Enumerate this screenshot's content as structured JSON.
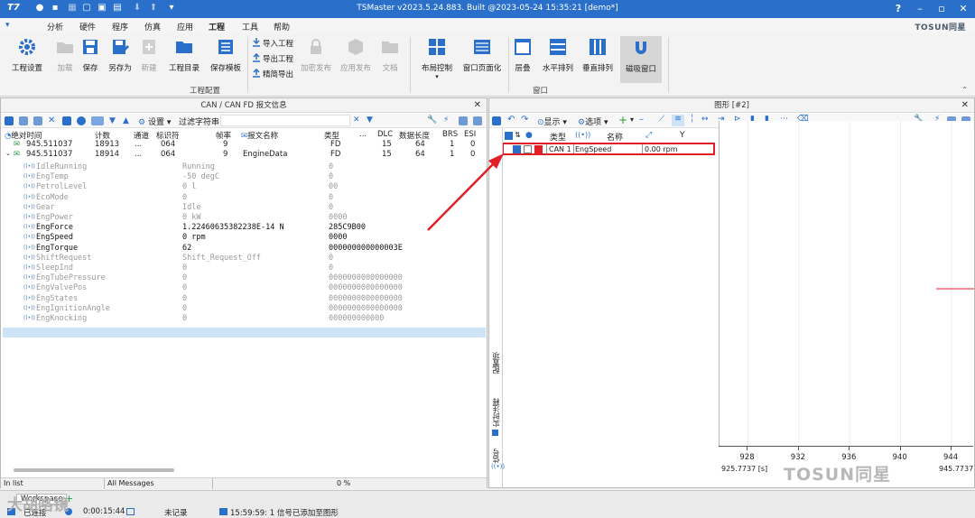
{
  "app": {
    "title": "TSMaster v2023.5.24.883. Built @2023-05-24 15:35:21 [demo*]"
  },
  "menu": {
    "items": [
      "分析",
      "硬件",
      "程序",
      "仿真",
      "应用",
      "工程",
      "工具",
      "帮助"
    ],
    "active": "工程",
    "brand": "TOSUN同星"
  },
  "ribbon": {
    "buttons": {
      "settings": "工程设置",
      "load": "加载",
      "save": "保存",
      "saveas": "另存为",
      "new": "新建",
      "dir": "工程目录",
      "savetpl": "保存模板",
      "import": "导入工程",
      "export": "导出工程",
      "simple": "精简导出",
      "encrypt": "加密发布",
      "publish": "应用发布",
      "doc": "文档",
      "layout": "布局控制",
      "pageize": "窗口页面化",
      "cascade": "层叠",
      "horiz": "水平排列",
      "vert": "垂直排列",
      "magnet": "磁吸窗口"
    },
    "group_project": "工程配置",
    "group_window": "窗口"
  },
  "can_panel": {
    "title": "CAN / CAN FD 报文信息",
    "settings_label": "设置",
    "filter_label": "过滤字符串:",
    "columns": [
      "绝对时间",
      "计数",
      "通道",
      "标识符",
      "帧率",
      "报文名称",
      "类型",
      "...",
      "DLC",
      "数据长度",
      "BRS",
      "ESI"
    ],
    "rows": [
      {
        "time": "945.511037",
        "count": "18913",
        "ch": "...",
        "id": "064",
        "rate": "9",
        "name": "",
        "type": "FD",
        "dots": "...",
        "dlc": "15",
        "len": "64",
        "brs": "1",
        "esi": "0"
      },
      {
        "time": "945.511037",
        "count": "18914",
        "ch": "...",
        "id": "064",
        "rate": "9",
        "name": "EngineData",
        "type": "FD",
        "dots": "...",
        "dlc": "15",
        "len": "64",
        "brs": "1",
        "esi": "0"
      }
    ],
    "signals": [
      {
        "name": "IdleRunning",
        "value": "Running",
        "raw": "0",
        "on": false
      },
      {
        "name": "EngTemp",
        "value": "-50 degC",
        "raw": "0",
        "on": false
      },
      {
        "name": "PetrolLevel",
        "value": "0 l",
        "raw": "00",
        "on": false
      },
      {
        "name": "EcoMode",
        "value": "0",
        "raw": "0",
        "on": false
      },
      {
        "name": "Gear",
        "value": "Idle",
        "raw": "0",
        "on": false
      },
      {
        "name": "EngPower",
        "value": "0 kW",
        "raw": "0000",
        "on": false
      },
      {
        "name": "EngForce",
        "value": "1.22460635382238E-14 N",
        "raw": "285C9B00",
        "on": true
      },
      {
        "name": "EngSpeed",
        "value": "0 rpm",
        "raw": "0000",
        "on": true
      },
      {
        "name": "EngTorque",
        "value": "62",
        "raw": "000000000000003E",
        "on": true
      },
      {
        "name": "ShiftRequest",
        "value": "Shift_Request_Off",
        "raw": "0",
        "on": false
      },
      {
        "name": "SleepInd",
        "value": "0",
        "raw": "0",
        "on": false
      },
      {
        "name": "EngTubePressure",
        "value": "0",
        "raw": "0000000000000000",
        "on": false
      },
      {
        "name": "EngValvePos",
        "value": "0",
        "raw": "0000000000000000",
        "on": false
      },
      {
        "name": "EngStates",
        "value": "0",
        "raw": "0000000000000000",
        "on": false
      },
      {
        "name": "EngIgnitionAngle",
        "value": "0",
        "raw": "0000000000000000",
        "on": false
      },
      {
        "name": "EngKnocking",
        "value": "0",
        "raw": "000000000000",
        "on": false
      }
    ],
    "status": {
      "mode": "In list",
      "filter": "All Messages",
      "progress": "0 %"
    }
  },
  "graph_panel": {
    "title": "图形 [#2]",
    "display_label": "显示",
    "options_label": "选项",
    "sig_headers": {
      "type": "类型",
      "name": "名称",
      "y": "Y"
    },
    "signal": {
      "type": "CAN 1",
      "name": "EngSpeed",
      "y": "0.00 rpm",
      "color": "#e01f26"
    },
    "side_tabs": [
      "配置项",
      "实时注释",
      "信号"
    ],
    "x_ticks": [
      "928",
      "932",
      "936",
      "940",
      "944"
    ],
    "x_start": "925.7737 [s]",
    "x_end": "945.7737"
  },
  "footer": {
    "tab": "Workspace",
    "connected": "已连接",
    "time": "0:00:15:44",
    "recording": "未记录",
    "message": "15:59:59: 1 信号已添加至图形"
  },
  "watermark": {
    "main": "TOSUN同星",
    "left": "大胡咯镜"
  }
}
